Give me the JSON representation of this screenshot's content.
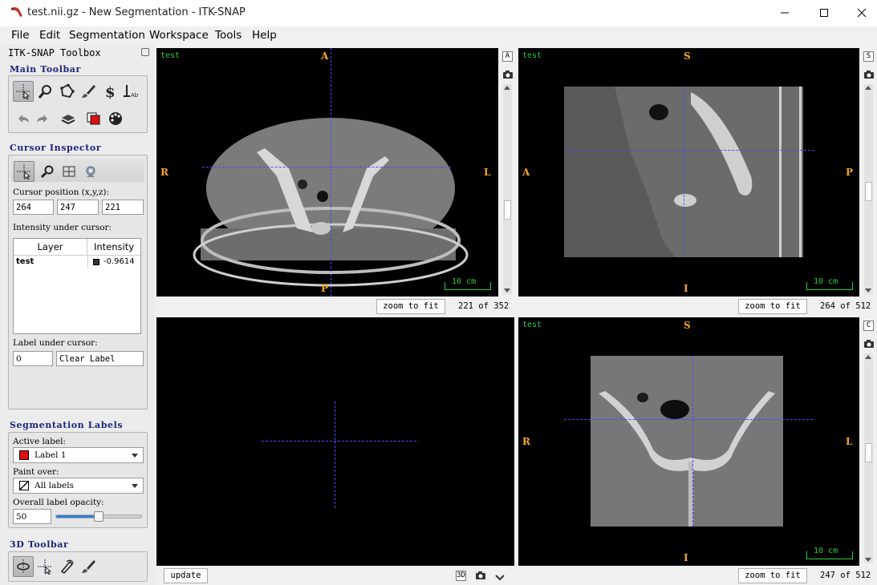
{
  "window": {
    "title": "test.nii.gz - New Segmentation - ITK-SNAP"
  },
  "menu": [
    "File",
    "Edit",
    "Segmentation",
    "Workspace",
    "Tools",
    "Help"
  ],
  "toolbox": {
    "title": "ITK-SNAP Toolbox",
    "main_toolbar": {
      "title": "Main Toolbar"
    },
    "cursor_inspector": {
      "title": "Cursor Inspector",
      "position_label": "Cursor position (x,y,z):",
      "x": "264",
      "y": "247",
      "z": "221",
      "intensity_label": "Intensity under cursor:",
      "table_headers": [
        "Layer",
        "Intensity"
      ],
      "rows": [
        {
          "layer": "test",
          "intensity": "-0.9614"
        }
      ],
      "label_under_cursor": "Label under cursor:",
      "label_id": "0",
      "label_name": "Clear Label"
    },
    "segmentation_labels": {
      "title": "Segmentation Labels",
      "active_label_caption": "Active label:",
      "active_label": "Label 1",
      "active_color": "#e01010",
      "paint_over_caption": "Paint over:",
      "paint_over": "All labels",
      "opacity_caption": "Overall label opacity:",
      "opacity_value": "50",
      "opacity_fraction": 0.5
    },
    "toolbar_3d": {
      "title": "3D Toolbar"
    }
  },
  "views": {
    "axial": {
      "layer": "test",
      "top": "A",
      "bottom": "P",
      "left": "R",
      "right": "L",
      "side_button": "A",
      "scale": "10 cm",
      "zoom": "zoom to fit",
      "slice": "221 of 352"
    },
    "sagittal": {
      "layer": "test",
      "top": "S",
      "bottom": "I",
      "left": "A",
      "right": "P",
      "side_button": "S",
      "scale": "10 cm",
      "zoom": "zoom to fit",
      "slice": "264 of 512"
    },
    "three_d": {
      "update": "update",
      "mode_button": "3D"
    },
    "coronal": {
      "layer": "test",
      "top": "S",
      "bottom": "I",
      "left": "R",
      "right": "L",
      "side_button": "C",
      "scale": "10 cm",
      "zoom": "zoom to fit",
      "slice": "247 of 512"
    }
  }
}
